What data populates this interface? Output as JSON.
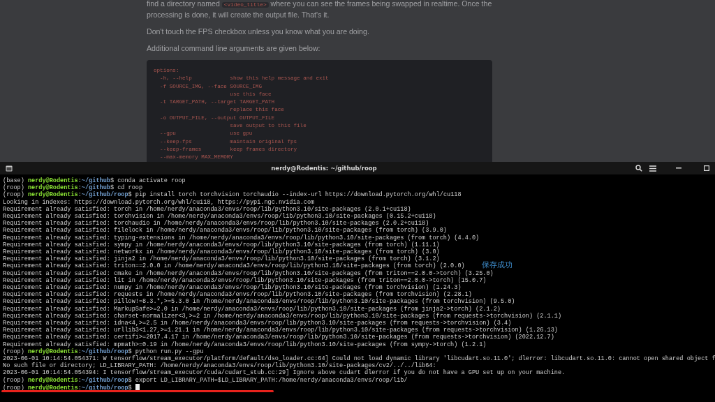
{
  "article": {
    "paragraphs": [
      {
        "before": "find a directory named ",
        "code": "<video_title>",
        "after": " where you can see the frames being swapped in realtime. Once the processing is done, it will create the output file. That's it."
      },
      {
        "before": "Don't touch the FPS checkbox unless you know what you are doing."
      },
      {
        "before": "Additional command line arguments are given below:"
      }
    ],
    "code_block": [
      "options:",
      "  -h, --help            show this help message and exit",
      "  -f SOURCE_IMG, --face SOURCE_IMG",
      "                        use this face",
      "  -t TARGET_PATH, --target TARGET_PATH",
      "                        replace this face",
      "  -o OUTPUT_FILE, --output OUTPUT_FILE",
      "                        save output to this file",
      "  --gpu                 use gpu",
      "  --keep-fps            maintain original fps",
      "  --keep-frames         keep frames directory",
      "  --max-memory MAX_MEMORY"
    ]
  },
  "terminal": {
    "title": "nerdy@Rodentis: ~/github/roop",
    "lines": [
      {
        "kind": "prompt",
        "env": "(base) ",
        "user": "nerdy@Rodentis",
        "path": "~/github",
        "command": "conda activate roop"
      },
      {
        "kind": "prompt",
        "env": "(roop) ",
        "user": "nerdy@Rodentis",
        "path": "~/github",
        "command": "cd roop"
      },
      {
        "kind": "prompt",
        "env": "(roop) ",
        "user": "nerdy@Rodentis",
        "path": "~/github/roop",
        "command": "pip install torch torchvision torchaudio --index-url https://download.pytorch.org/whl/cu118"
      },
      {
        "kind": "output",
        "text": "Looking in indexes: https://download.pytorch.org/whl/cu118, https://pypi.ngc.nvidia.com"
      },
      {
        "kind": "output",
        "text": "Requirement already satisfied: torch in /home/nerdy/anaconda3/envs/roop/lib/python3.10/site-packages (2.0.1+cu118)"
      },
      {
        "kind": "output",
        "text": "Requirement already satisfied: torchvision in /home/nerdy/anaconda3/envs/roop/lib/python3.10/site-packages (0.15.2+cu118)"
      },
      {
        "kind": "output",
        "text": "Requirement already satisfied: torchaudio in /home/nerdy/anaconda3/envs/roop/lib/python3.10/site-packages (2.0.2+cu118)"
      },
      {
        "kind": "output",
        "text": "Requirement already satisfied: filelock in /home/nerdy/anaconda3/envs/roop/lib/python3.10/site-packages (from torch) (3.9.0)"
      },
      {
        "kind": "output",
        "text": "Requirement already satisfied: typing-extensions in /home/nerdy/anaconda3/envs/roop/lib/python3.10/site-packages (from torch) (4.4.0)"
      },
      {
        "kind": "output",
        "text": "Requirement already satisfied: sympy in /home/nerdy/anaconda3/envs/roop/lib/python3.10/site-packages (from torch) (1.11.1)"
      },
      {
        "kind": "output",
        "text": "Requirement already satisfied: networkx in /home/nerdy/anaconda3/envs/roop/lib/python3.10/site-packages (from torch) (3.0)"
      },
      {
        "kind": "output",
        "text": "Requirement already satisfied: jinja2 in /home/nerdy/anaconda3/envs/roop/lib/python3.10/site-packages (from torch) (3.1.2)"
      },
      {
        "kind": "output",
        "text": "Requirement already satisfied: triton==2.0.0 in /home/nerdy/anaconda3/envs/roop/lib/python3.10/site-packages (from torch) (2.0.0)"
      },
      {
        "kind": "output",
        "text": "Requirement already satisfied: cmake in /home/nerdy/anaconda3/envs/roop/lib/python3.10/site-packages (from triton==2.0.0->torch) (3.25.0)"
      },
      {
        "kind": "output",
        "text": "Requirement already satisfied: lit in /home/nerdy/anaconda3/envs/roop/lib/python3.10/site-packages (from triton==2.0.0->torch) (15.0.7)"
      },
      {
        "kind": "output",
        "text": "Requirement already satisfied: numpy in /home/nerdy/anaconda3/envs/roop/lib/python3.10/site-packages (from torchvision) (1.24.3)"
      },
      {
        "kind": "output",
        "text": "Requirement already satisfied: requests in /home/nerdy/anaconda3/envs/roop/lib/python3.10/site-packages (from torchvision) (2.28.1)"
      },
      {
        "kind": "output",
        "text": "Requirement already satisfied: pillow!=8.3.*,>=5.3.0 in /home/nerdy/anaconda3/envs/roop/lib/python3.10/site-packages (from torchvision) (9.5.0)"
      },
      {
        "kind": "output",
        "text": "Requirement already satisfied: MarkupSafe>=2.0 in /home/nerdy/anaconda3/envs/roop/lib/python3.10/site-packages (from jinja2->torch) (2.1.2)"
      },
      {
        "kind": "output",
        "text": "Requirement already satisfied: charset-normalizer<3,>=2 in /home/nerdy/anaconda3/envs/roop/lib/python3.10/site-packages (from requests->torchvision) (2.1.1)"
      },
      {
        "kind": "output",
        "text": "Requirement already satisfied: idna<4,>=2.5 in /home/nerdy/anaconda3/envs/roop/lib/python3.10/site-packages (from requests->torchvision) (3.4)"
      },
      {
        "kind": "output",
        "text": "Requirement already satisfied: urllib3<1.27,>=1.21.1 in /home/nerdy/anaconda3/envs/roop/lib/python3.10/site-packages (from requests->torchvision) (1.26.13)"
      },
      {
        "kind": "output",
        "text": "Requirement already satisfied: certifi>=2017.4.17 in /home/nerdy/anaconda3/envs/roop/lib/python3.10/site-packages (from requests->torchvision) (2022.12.7)"
      },
      {
        "kind": "output",
        "text": "Requirement already satisfied: mpmath>=0.19 in /home/nerdy/anaconda3/envs/roop/lib/python3.10/site-packages (from sympy->torch) (1.2.1)"
      },
      {
        "kind": "prompt",
        "env": "(roop) ",
        "user": "nerdy@Rodentis",
        "path": "~/github/roop",
        "command": "python run.py --gpu"
      },
      {
        "kind": "output",
        "text": "2023-06-01 10:14:54.054371: W tensorflow/stream_executor/platform/default/dso_loader.cc:64] Could not load dynamic library 'libcudart.so.11.0'; dlerror: libcudart.so.11.0: cannot open shared object f"
      },
      {
        "kind": "output",
        "text": "No such file or directory; LD_LIBRARY_PATH: /home/nerdy/anaconda3/envs/roop/lib/python3.10/site-packages/cv2/../../lib64:"
      },
      {
        "kind": "output",
        "text": "2023-06-01 10:14:54.054394: I tensorflow/stream_executor/cuda/cudart_stub.cc:29] Ignore above cudart dlerror if you do not have a GPU set up on your machine."
      },
      {
        "kind": "prompt",
        "env": "(roop) ",
        "user": "nerdy@Rodentis",
        "path": "~/github/roop",
        "command": "export LD_LIBRARY_PATH=$LD_LIBRARY_PATH:/home/nerdy/anaconda3/envs/roop/lib/"
      },
      {
        "kind": "prompt",
        "env": "(roop) ",
        "user": "nerdy@Rodentis",
        "path": "~/github/roop",
        "cursor": true,
        "underlined": true
      }
    ]
  },
  "prompt_separator": ":",
  "prompt_symbol": "$ ",
  "toast": "保存成功"
}
